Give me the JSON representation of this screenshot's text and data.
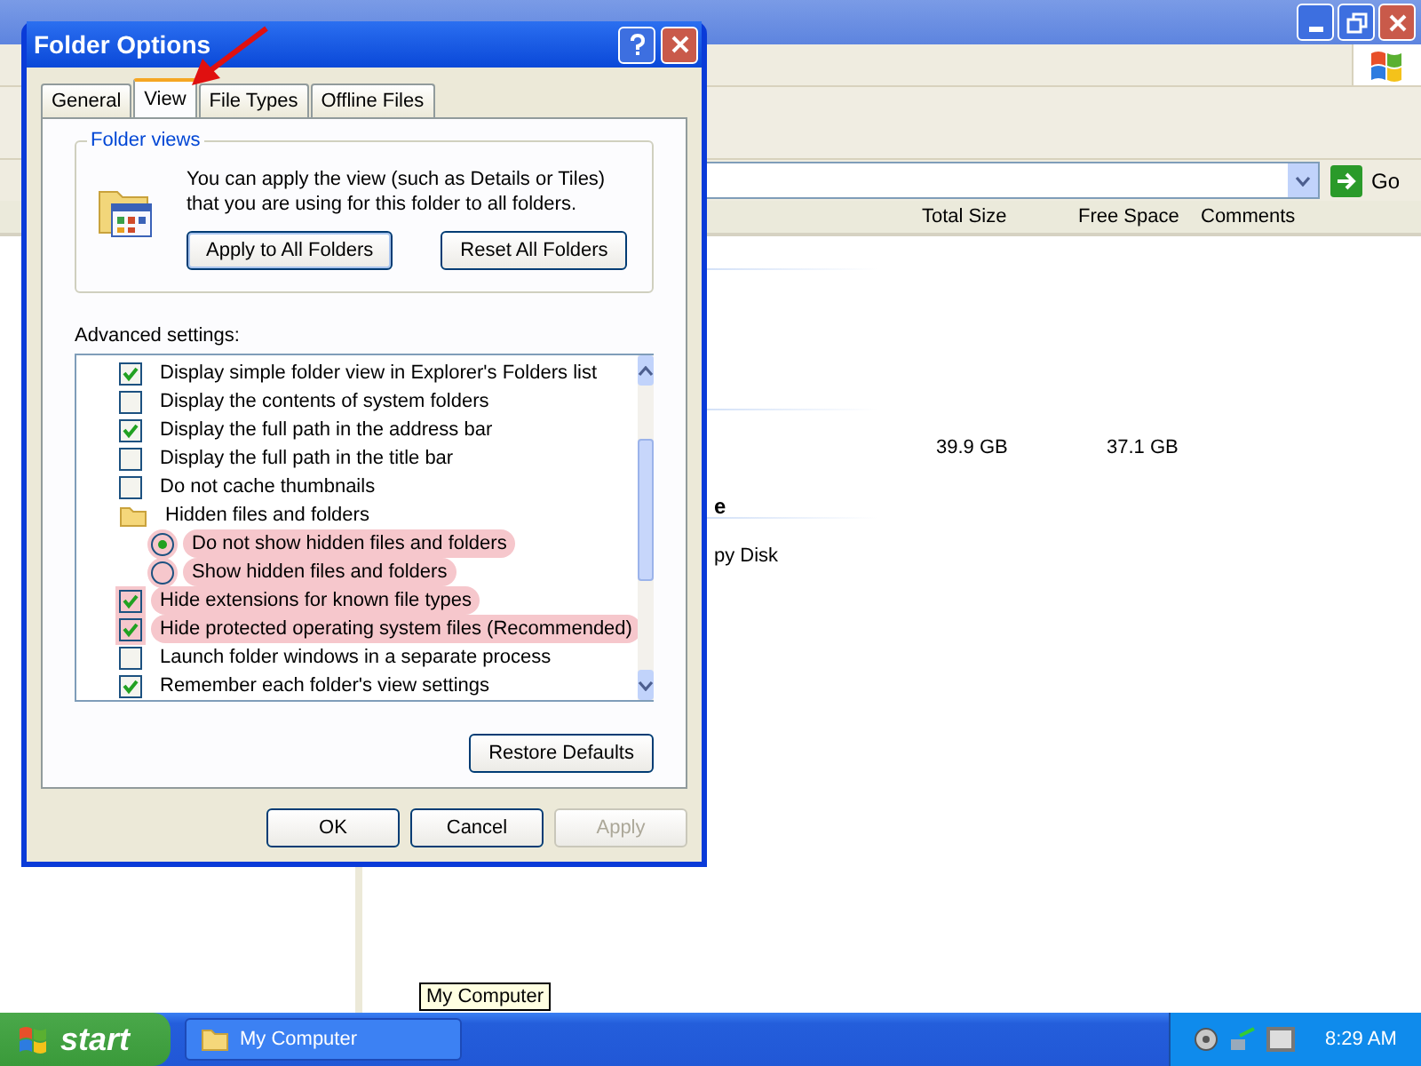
{
  "explorer": {
    "go_label": "Go",
    "columns": [
      "Total Size",
      "Free Space",
      "Comments"
    ],
    "rows": [
      {
        "column_1": "",
        "total_size": "39.9 GB",
        "free_space": "37.1 GB"
      }
    ],
    "fragments": [
      "e",
      "py Disk"
    ]
  },
  "dialog": {
    "title": "Folder Options",
    "tabs": [
      {
        "label": "General",
        "selected": false
      },
      {
        "label": "View",
        "selected": true
      },
      {
        "label": "File Types",
        "selected": false
      },
      {
        "label": "Offline Files",
        "selected": false
      }
    ],
    "folder_views": {
      "legend": "Folder views",
      "description": "You can apply the view (such as Details or Tiles) that you are using for this folder to all folders.",
      "buttons": [
        "Apply to All Folders",
        "Reset All Folders"
      ]
    },
    "advanced_label": "Advanced settings:",
    "settings": [
      {
        "kind": "checkbox",
        "label": "Display simple folder view in Explorer's Folders list",
        "checked": true,
        "highlighted": false
      },
      {
        "kind": "checkbox",
        "label": "Display the contents of system folders",
        "checked": false,
        "highlighted": false
      },
      {
        "kind": "checkbox",
        "label": "Display the full path in the address bar",
        "checked": true,
        "highlighted": false
      },
      {
        "kind": "checkbox",
        "label": "Display the full path in the title bar",
        "checked": false,
        "highlighted": false
      },
      {
        "kind": "checkbox",
        "label": "Do not cache thumbnails",
        "checked": false,
        "highlighted": false
      },
      {
        "kind": "folder",
        "label": "Hidden files and folders",
        "highlighted": false
      },
      {
        "kind": "radio",
        "label": "Do not show hidden files and folders",
        "selected": true,
        "highlighted": true
      },
      {
        "kind": "radio",
        "label": "Show hidden files and folders",
        "selected": false,
        "highlighted": true
      },
      {
        "kind": "checkbox",
        "label": "Hide extensions for known file types",
        "checked": true,
        "highlighted": true
      },
      {
        "kind": "checkbox",
        "label": "Hide protected operating system files (Recommended)",
        "checked": true,
        "highlighted": true
      },
      {
        "kind": "checkbox",
        "label": "Launch folder windows in a separate process",
        "checked": false,
        "highlighted": false
      },
      {
        "kind": "checkbox",
        "label": "Remember each folder's view settings",
        "checked": true,
        "highlighted": false
      }
    ],
    "restore_button": "Restore Defaults",
    "buttons": [
      {
        "label": "OK",
        "disabled": false
      },
      {
        "label": "Cancel",
        "disabled": false
      },
      {
        "label": "Apply",
        "disabled": true
      }
    ]
  },
  "tooltip": "My Computer",
  "taskbar": {
    "start": "start",
    "tasks": [
      "My Computer"
    ],
    "clock": "8:29 AM"
  }
}
